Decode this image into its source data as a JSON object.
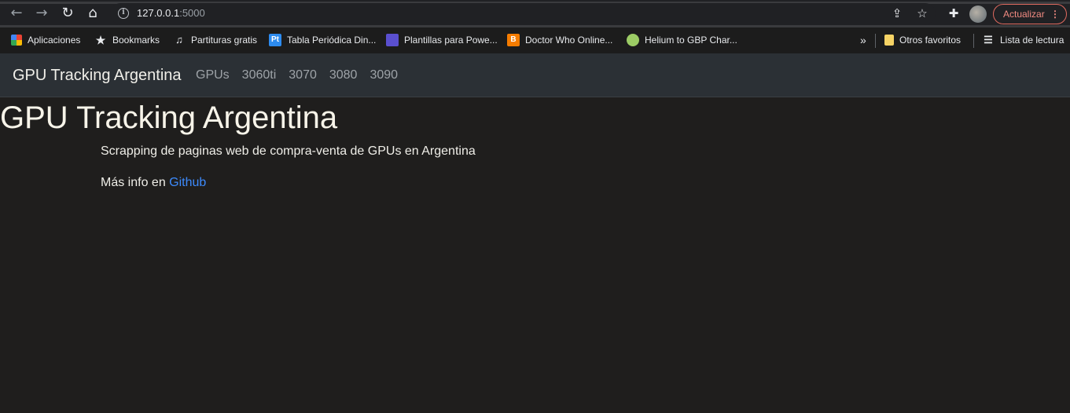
{
  "browser": {
    "url_host": "127.0.0.1",
    "url_port": ":5000",
    "update_label": "Actualizar"
  },
  "bookmarks": {
    "items": [
      {
        "label": "Aplicaciones",
        "icon": "apps-grid-icon"
      },
      {
        "label": "Bookmarks",
        "icon": "star-icon"
      },
      {
        "label": "Partituras gratis",
        "icon": "music-note-icon"
      },
      {
        "label": "Tabla Periódica Din...",
        "icon": "pt-icon"
      },
      {
        "label": "Plantillas para Powe...",
        "icon": "slides-icon"
      },
      {
        "label": "Doctor Who Online...",
        "icon": "blogger-icon"
      },
      {
        "label": "Helium to GBP Char...",
        "icon": "coin-icon"
      }
    ],
    "more": "»",
    "other_favorites": "Otros favoritos",
    "reading_list": "Lista de lectura"
  },
  "site": {
    "brand": "GPU Tracking Argentina",
    "nav": [
      "GPUs",
      "3060ti",
      "3070",
      "3080",
      "3090"
    ]
  },
  "main": {
    "title": "GPU Tracking Argentina",
    "description": "Scrapping de paginas web de compra-venta de GPUs en Argentina",
    "more_info_prefix": "Más info en",
    "more_info_link": "Github"
  },
  "colors": {
    "page_bg": "#1f1e1d",
    "navbar_bg": "#2b3035",
    "link": "#3d8bfd",
    "update_accent": "#f28b82"
  }
}
